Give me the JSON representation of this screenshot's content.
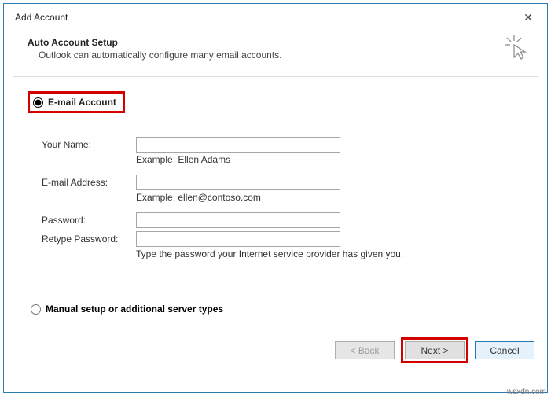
{
  "window": {
    "title": "Add Account"
  },
  "header": {
    "title": "Auto Account Setup",
    "subtitle": "Outlook can automatically configure many email accounts."
  },
  "options": {
    "email_label": "E-mail Account",
    "manual_label": "Manual setup or additional server types"
  },
  "form": {
    "name_label": "Your Name:",
    "name_hint": "Example: Ellen Adams",
    "email_label": "E-mail Address:",
    "email_hint": "Example: ellen@contoso.com",
    "password_label": "Password:",
    "retype_label": "Retype Password:",
    "password_hint": "Type the password your Internet service provider has given you."
  },
  "buttons": {
    "back": "< Back",
    "next": "Next >",
    "cancel": "Cancel"
  },
  "watermark": "wsxdn.com"
}
